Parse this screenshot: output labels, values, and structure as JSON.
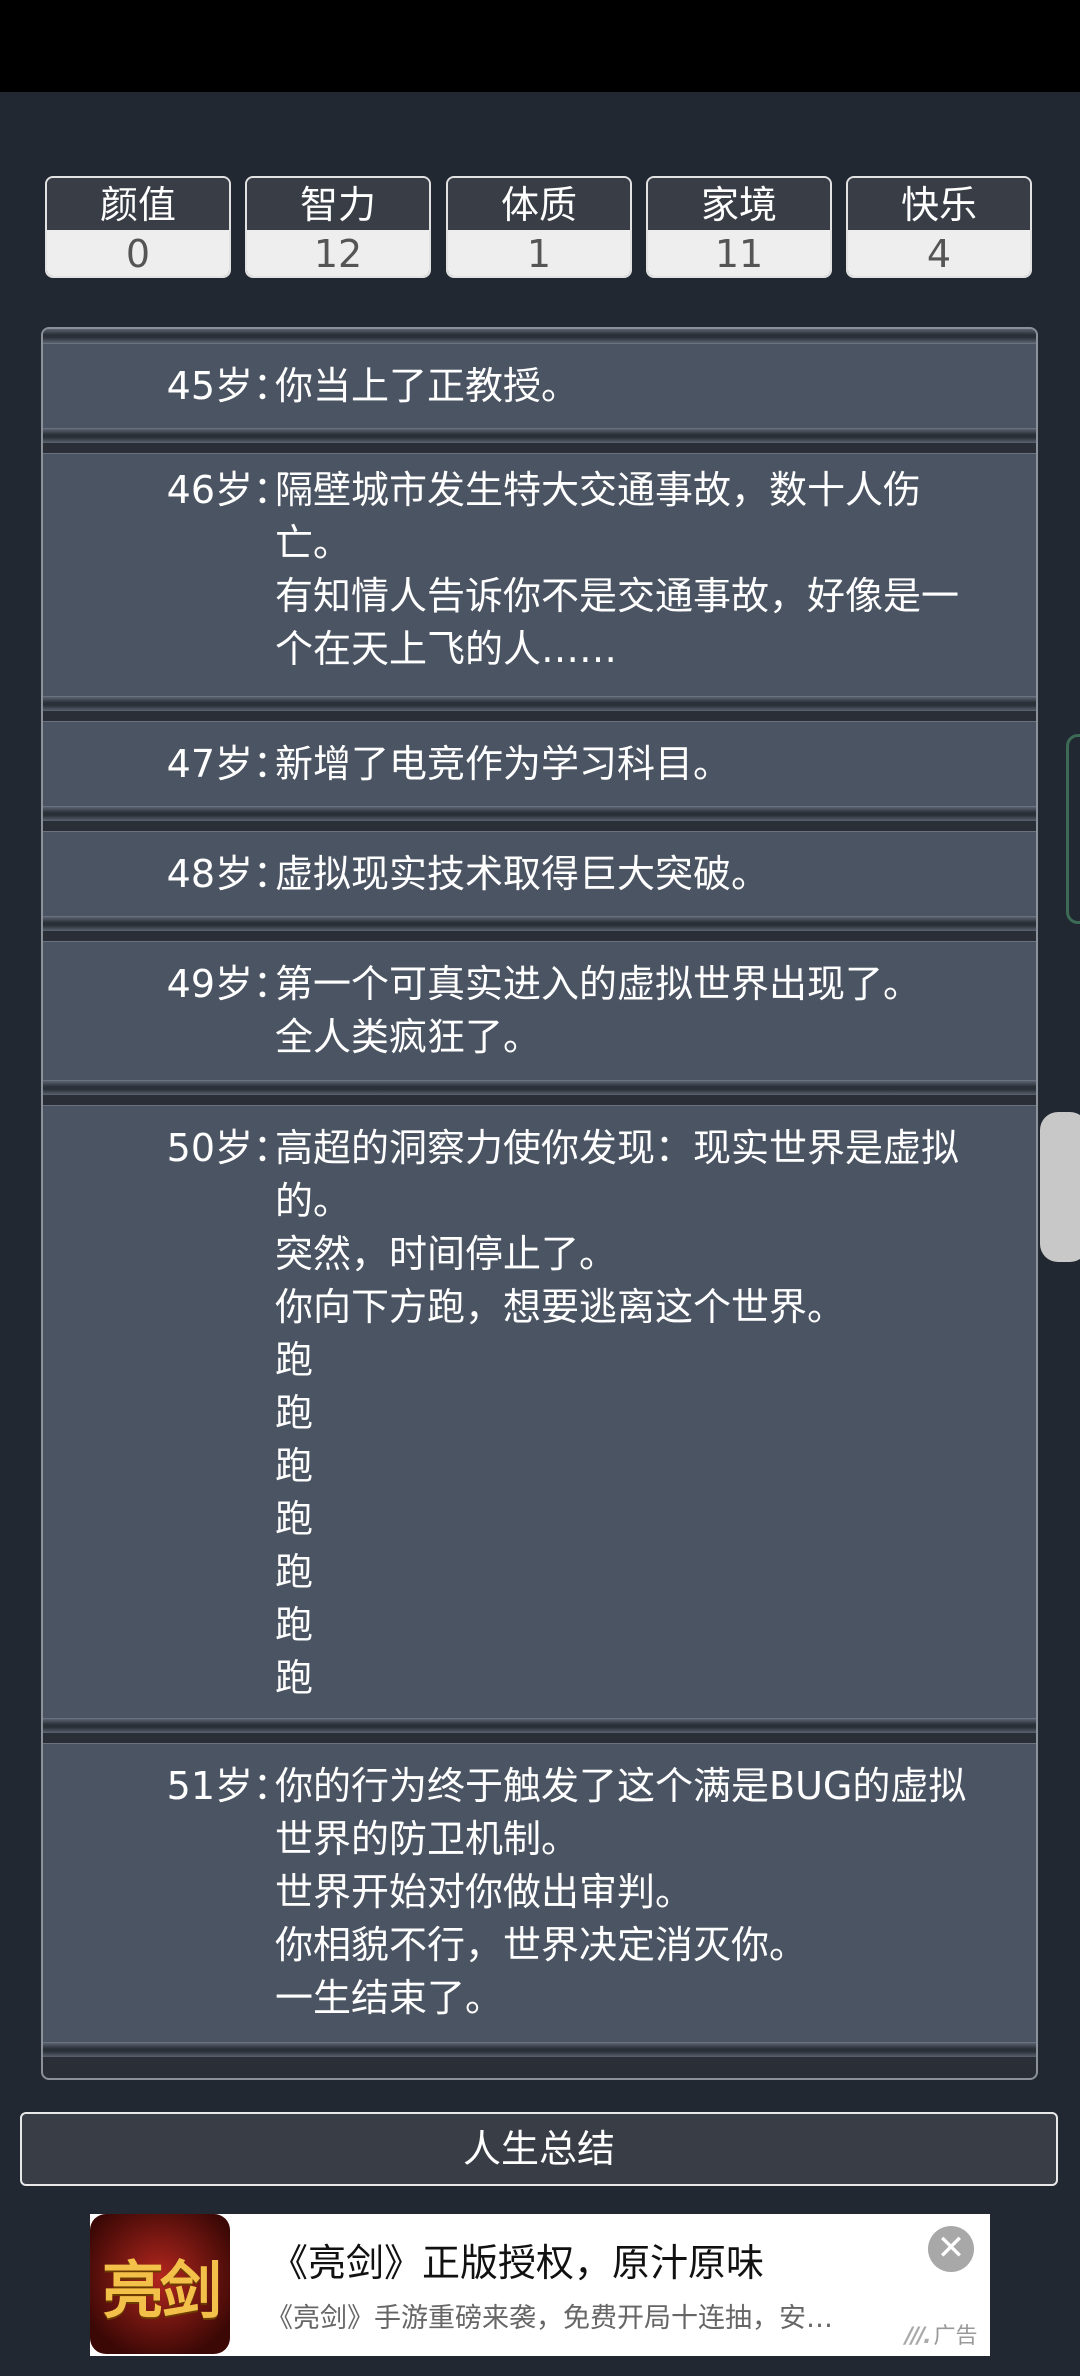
{
  "stats": [
    {
      "label": "颜值",
      "value": "0"
    },
    {
      "label": "智力",
      "value": "12"
    },
    {
      "label": "体质",
      "value": "1"
    },
    {
      "label": "家境",
      "value": "11"
    },
    {
      "label": "快乐",
      "value": "4"
    }
  ],
  "events": [
    {
      "age": "45岁：",
      "lines": [
        "你当上了正教授。"
      ]
    },
    {
      "age": "46岁：",
      "lines": [
        "隔壁城市发生特大交通事故，数十人伤",
        "亡。",
        "有知情人告诉你不是交通事故，好像是一",
        "个在天上飞的人……"
      ]
    },
    {
      "age": "47岁：",
      "lines": [
        "新增了电竞作为学习科目。"
      ]
    },
    {
      "age": "48岁：",
      "lines": [
        "虚拟现实技术取得巨大突破。"
      ]
    },
    {
      "age": "49岁：",
      "lines": [
        "第一个可真实进入的虚拟世界出现了。",
        "全人类疯狂了。"
      ]
    },
    {
      "age": "50岁：",
      "lines": [
        "高超的洞察力使你发现：现实世界是虚拟",
        "的。",
        "突然，时间停止了。",
        "你向下方跑，想要逃离这个世界。",
        "跑",
        "跑",
        "跑",
        "跑",
        "跑",
        "跑",
        "跑"
      ]
    },
    {
      "age": "51岁：",
      "lines": [
        "你的行为终于触发了这个满是BUG的虚拟",
        "世界的防卫机制。",
        "世界开始对你做出审判。",
        "你相貌不行，世界决定消灭你。",
        "一生结束了。"
      ]
    }
  ],
  "summary_button": "人生总结",
  "ad": {
    "icon_text": "亮剑",
    "title": "《亮剑》正版授权，原汁原味",
    "description": "《亮剑》手游重磅来袭，免费开局十连抽，安…",
    "tag": "广告",
    "close": "✕"
  }
}
